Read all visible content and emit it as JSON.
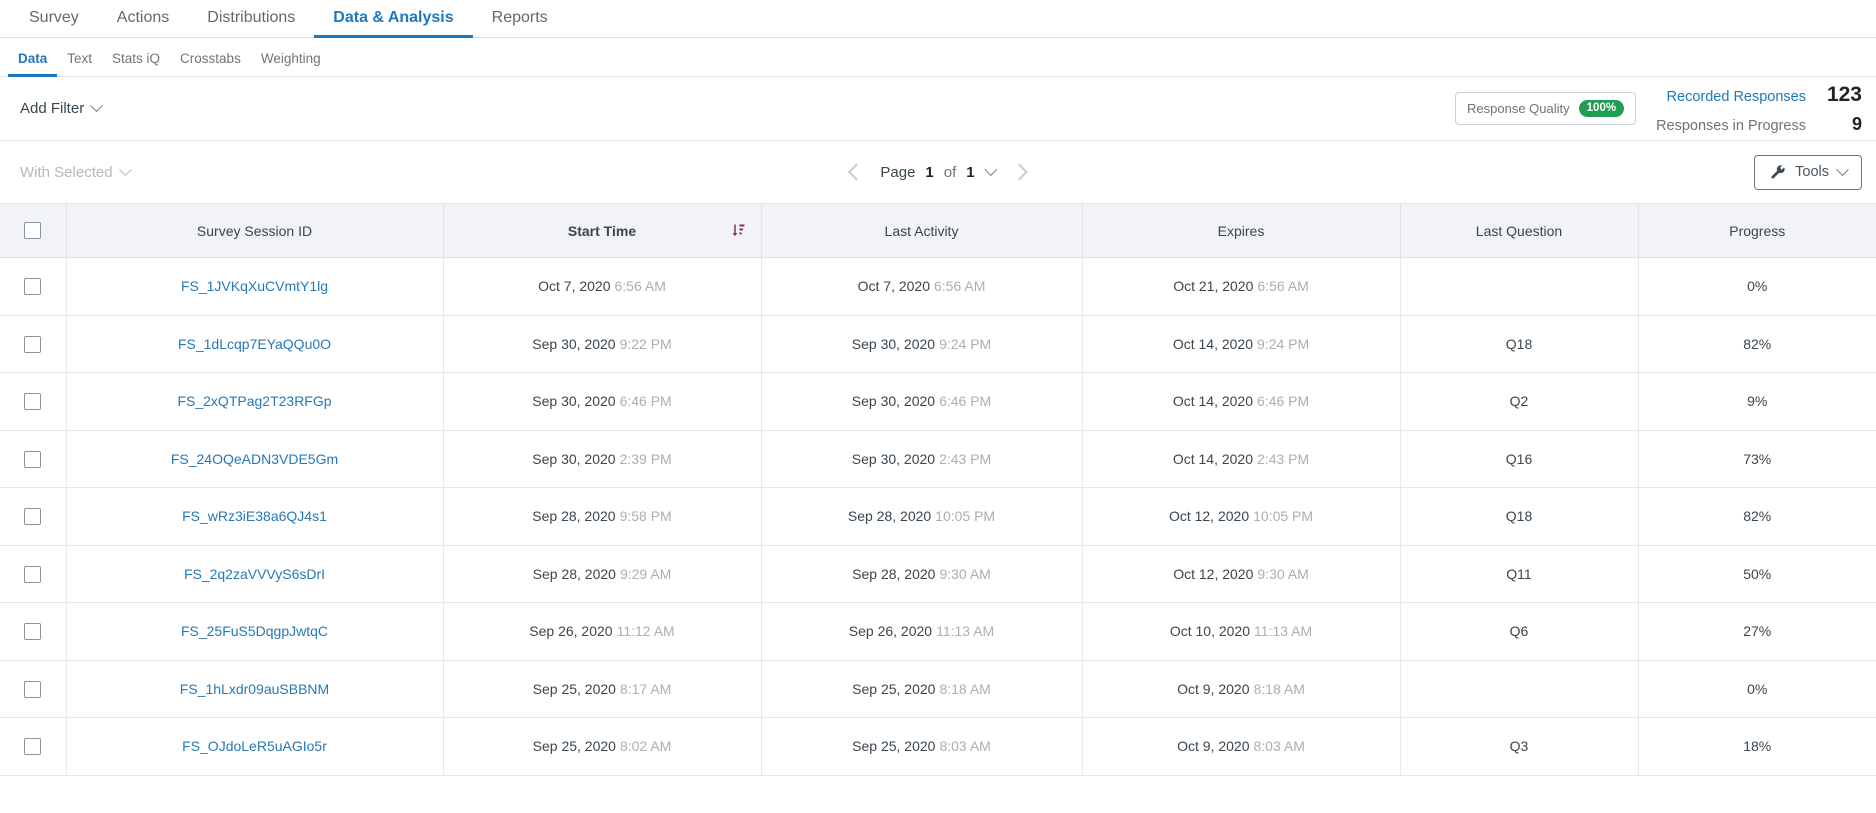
{
  "top_nav": {
    "items": [
      {
        "label": "Survey",
        "active": false
      },
      {
        "label": "Actions",
        "active": false
      },
      {
        "label": "Distributions",
        "active": false
      },
      {
        "label": "Data & Analysis",
        "active": true
      },
      {
        "label": "Reports",
        "active": false
      }
    ]
  },
  "sub_nav": {
    "items": [
      {
        "label": "Data",
        "active": true
      },
      {
        "label": "Text",
        "active": false
      },
      {
        "label": "Stats iQ",
        "active": false
      },
      {
        "label": "Crosstabs",
        "active": false
      },
      {
        "label": "Weighting",
        "active": false
      }
    ]
  },
  "filter_bar": {
    "add_filter_label": "Add Filter",
    "response_quality_label": "Response Quality",
    "response_quality_value": "100%",
    "recorded_responses_label": "Recorded Responses",
    "recorded_responses_value": "123",
    "responses_in_progress_label": "Responses in Progress",
    "responses_in_progress_value": "9"
  },
  "actions_bar": {
    "with_selected_label": "With Selected",
    "page_word": "Page",
    "page_current": "1",
    "page_of": "of",
    "page_total": "1",
    "tools_label": "Tools"
  },
  "table": {
    "columns": [
      {
        "key": "checkbox",
        "label": ""
      },
      {
        "key": "session_id",
        "label": "Survey Session ID"
      },
      {
        "key": "start_time",
        "label": "Start Time",
        "sorted": true,
        "sort_dir": "desc"
      },
      {
        "key": "last_activity",
        "label": "Last Activity"
      },
      {
        "key": "expires",
        "label": "Expires"
      },
      {
        "key": "last_question",
        "label": "Last Question"
      },
      {
        "key": "progress",
        "label": "Progress"
      }
    ],
    "rows": [
      {
        "session_id": "FS_1JVKqXuCVmtY1lg",
        "start_date": "Oct 7, 2020",
        "start_time": "6:56 AM",
        "activity_date": "Oct 7, 2020",
        "activity_time": "6:56 AM",
        "expires_date": "Oct 21, 2020",
        "expires_time": "6:56 AM",
        "last_question": "",
        "progress": "0%"
      },
      {
        "session_id": "FS_1dLcqp7EYaQQu0O",
        "start_date": "Sep 30, 2020",
        "start_time": "9:22 PM",
        "activity_date": "Sep 30, 2020",
        "activity_time": "9:24 PM",
        "expires_date": "Oct 14, 2020",
        "expires_time": "9:24 PM",
        "last_question": "Q18",
        "progress": "82%"
      },
      {
        "session_id": "FS_2xQTPag2T23RFGp",
        "start_date": "Sep 30, 2020",
        "start_time": "6:46 PM",
        "activity_date": "Sep 30, 2020",
        "activity_time": "6:46 PM",
        "expires_date": "Oct 14, 2020",
        "expires_time": "6:46 PM",
        "last_question": "Q2",
        "progress": "9%"
      },
      {
        "session_id": "FS_24OQeADN3VDE5Gm",
        "start_date": "Sep 30, 2020",
        "start_time": "2:39 PM",
        "activity_date": "Sep 30, 2020",
        "activity_time": "2:43 PM",
        "expires_date": "Oct 14, 2020",
        "expires_time": "2:43 PM",
        "last_question": "Q16",
        "progress": "73%"
      },
      {
        "session_id": "FS_wRz3iE38a6QJ4s1",
        "start_date": "Sep 28, 2020",
        "start_time": "9:58 PM",
        "activity_date": "Sep 28, 2020",
        "activity_time": "10:05 PM",
        "expires_date": "Oct 12, 2020",
        "expires_time": "10:05 PM",
        "last_question": "Q18",
        "progress": "82%"
      },
      {
        "session_id": "FS_2q2zaVVVyS6sDrI",
        "start_date": "Sep 28, 2020",
        "start_time": "9:29 AM",
        "activity_date": "Sep 28, 2020",
        "activity_time": "9:30 AM",
        "expires_date": "Oct 12, 2020",
        "expires_time": "9:30 AM",
        "last_question": "Q11",
        "progress": "50%"
      },
      {
        "session_id": "FS_25FuS5DqgpJwtqC",
        "start_date": "Sep 26, 2020",
        "start_time": "11:12 AM",
        "activity_date": "Sep 26, 2020",
        "activity_time": "11:13 AM",
        "expires_date": "Oct 10, 2020",
        "expires_time": "11:13 AM",
        "last_question": "Q6",
        "progress": "27%"
      },
      {
        "session_id": "FS_1hLxdr09auSBBNM",
        "start_date": "Sep 25, 2020",
        "start_time": "8:17 AM",
        "activity_date": "Sep 25, 2020",
        "activity_time": "8:18 AM",
        "expires_date": "Oct 9, 2020",
        "expires_time": "8:18 AM",
        "last_question": "",
        "progress": "0%"
      },
      {
        "session_id": "FS_OJdoLeR5uAGIo5r",
        "start_date": "Sep 25, 2020",
        "start_time": "8:02 AM",
        "activity_date": "Sep 25, 2020",
        "activity_time": "8:03 AM",
        "expires_date": "Oct 9, 2020",
        "expires_time": "8:03 AM",
        "last_question": "Q3",
        "progress": "18%"
      }
    ]
  },
  "colors": {
    "accent_blue": "#1c78bf",
    "link_blue": "#2779b5",
    "badge_green": "#1f9d55",
    "sort_icon": "#7b2d3a",
    "header_bg": "#f1f3f6"
  }
}
